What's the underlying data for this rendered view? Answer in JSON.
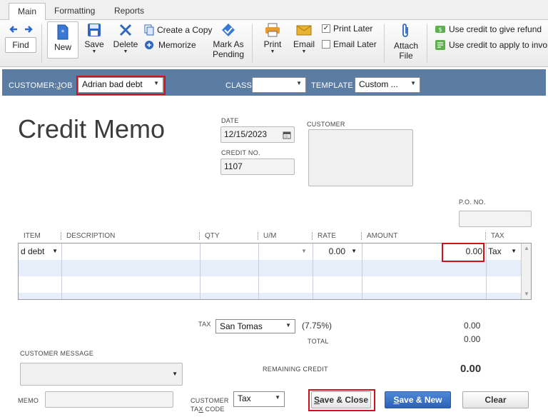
{
  "tabs": [
    {
      "label": "Main"
    },
    {
      "label": "Formatting"
    },
    {
      "label": "Reports"
    }
  ],
  "toolbar": {
    "find": "Find",
    "new": "New",
    "save": "Save",
    "delete": "Delete",
    "create_copy": "Create a Copy",
    "memorize": "Memorize",
    "mark_as_pending_1": "Mark As",
    "mark_as_pending_2": "Pending",
    "print": "Print",
    "email": "Email",
    "print_later": "Print Later",
    "email_later": "Email Later",
    "attach_1": "Attach",
    "attach_2": "File",
    "use_credit_refund": "Use credit to give refund",
    "use_credit_invoice": "Use credit to apply to invoice"
  },
  "customer_bar": {
    "customer_job_label_1": "CUSTOMER:",
    "customer_job_label_j": "J",
    "customer_job_label_2": "OB",
    "customer_job_value": "Adrian bad debt",
    "class_label": "CLASS",
    "class_value": "",
    "template_label": "TEMPLATE",
    "template_value": "Custom ..."
  },
  "form": {
    "title": "Credit Memo",
    "date_label": "DATE",
    "date_value": "12/15/2023",
    "credit_no_label": "CREDIT NO.",
    "credit_no_value": "1107",
    "customer_label": "CUSTOMER",
    "po_label": "P.O. NO."
  },
  "grid": {
    "headers": [
      "ITEM",
      "DESCRIPTION",
      "QTY",
      "U/M",
      "RATE",
      "AMOUNT",
      "TAX"
    ],
    "row1": {
      "item": "d debt",
      "rate": "0.00",
      "amount": "0.00",
      "tax": "Tax"
    }
  },
  "totals": {
    "tax_label": "TAX",
    "tax_value": "San Tomas",
    "tax_rate": "(7.75%)",
    "tax_amount": "0.00",
    "total_label": "TOTAL",
    "total_amount": "0.00",
    "remaining_credit_label": "REMAINING CREDIT",
    "remaining_credit_value": "0.00"
  },
  "footer": {
    "customer_message_label": "CUSTOMER MESSAGE",
    "memo_label": "MEMO",
    "customer_tax_code_label_1": "CUSTOMER",
    "customer_tax_code_label_2a": "TA",
    "customer_tax_code_label_2b": "X",
    "customer_tax_code_label_2c": " CODE",
    "customer_tax_code_value": "Tax",
    "save_close_1": "S",
    "save_close_2": "ave & Close",
    "save_new_1": "S",
    "save_new_2": "ave & New",
    "clear": "Clear"
  },
  "colors": {
    "accent_bar": "#5b7ca3",
    "highlight_red": "#d0121b",
    "primary_button": "#2c62b6"
  }
}
